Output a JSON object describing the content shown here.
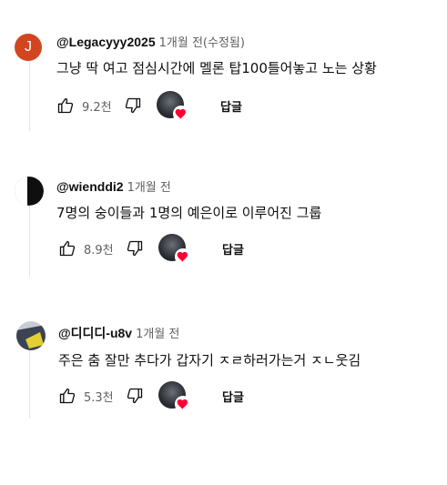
{
  "comments": [
    {
      "avatar_letter": "J",
      "author": "@Legacyyy2025",
      "time": "1개월 전(수정됨)",
      "text": "그냥 딱 여고 점심시간에 멜론 탑100틀어놓고 노는 상황",
      "likes": "9.2천",
      "reply_label": "답글"
    },
    {
      "author": "@wienddi2",
      "time": "1개월 전",
      "text": "7명의 숭이들과 1명의 예은이로 이루어진 그룹",
      "likes": "8.9천",
      "reply_label": "답글"
    },
    {
      "author": "@디디디-u8v",
      "time": "1개월 전",
      "text": "주은 춤 잘만 추다가 갑자기 ㅈㄹ하러가는거 ㅈㄴ웃김",
      "likes": "5.3천",
      "reply_label": "답글"
    }
  ],
  "colors": {
    "heart": "#ff0033",
    "avatar_j": "#d2461f",
    "muted_text": "#606060"
  },
  "icons": {
    "like": "thumbs-up-icon",
    "dislike": "thumbs-down-icon",
    "heart": "heart-icon"
  }
}
